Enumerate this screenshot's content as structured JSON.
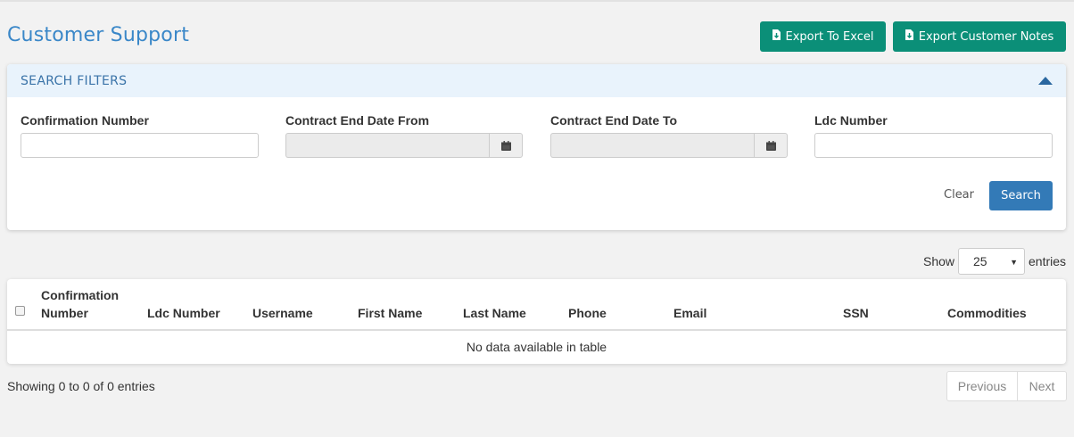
{
  "header": {
    "title": "Customer Support",
    "export_excel_label": "Export To Excel",
    "export_notes_label": "Export Customer Notes"
  },
  "filters": {
    "panel_title": "SEARCH FILTERS",
    "fields": [
      {
        "label": "Confirmation Number",
        "value": ""
      },
      {
        "label": "Contract End Date From",
        "value": ""
      },
      {
        "label": "Contract End Date To",
        "value": ""
      },
      {
        "label": "Ldc Number",
        "value": ""
      }
    ],
    "clear_label": "Clear",
    "search_label": "Search"
  },
  "table": {
    "show_label": "Show",
    "entries_value": "25",
    "entries_label": "entries",
    "columns": [
      {
        "label": "Confirmation Number"
      },
      {
        "label": "Ldc Number"
      },
      {
        "label": "Username"
      },
      {
        "label": "First Name"
      },
      {
        "label": "Last Name"
      },
      {
        "label": "Phone"
      },
      {
        "label": "Email"
      },
      {
        "label": "SSN"
      },
      {
        "label": "Commodities"
      }
    ],
    "empty_message": "No data available in table",
    "info": "Showing 0 to 0 of 0 entries",
    "prev_label": "Previous",
    "next_label": "Next"
  },
  "colors": {
    "accent_green": "#0b8f78",
    "primary_blue": "#337ab7",
    "title_blue": "#3a87c8",
    "panel_header_bg": "#e9f3fc"
  }
}
